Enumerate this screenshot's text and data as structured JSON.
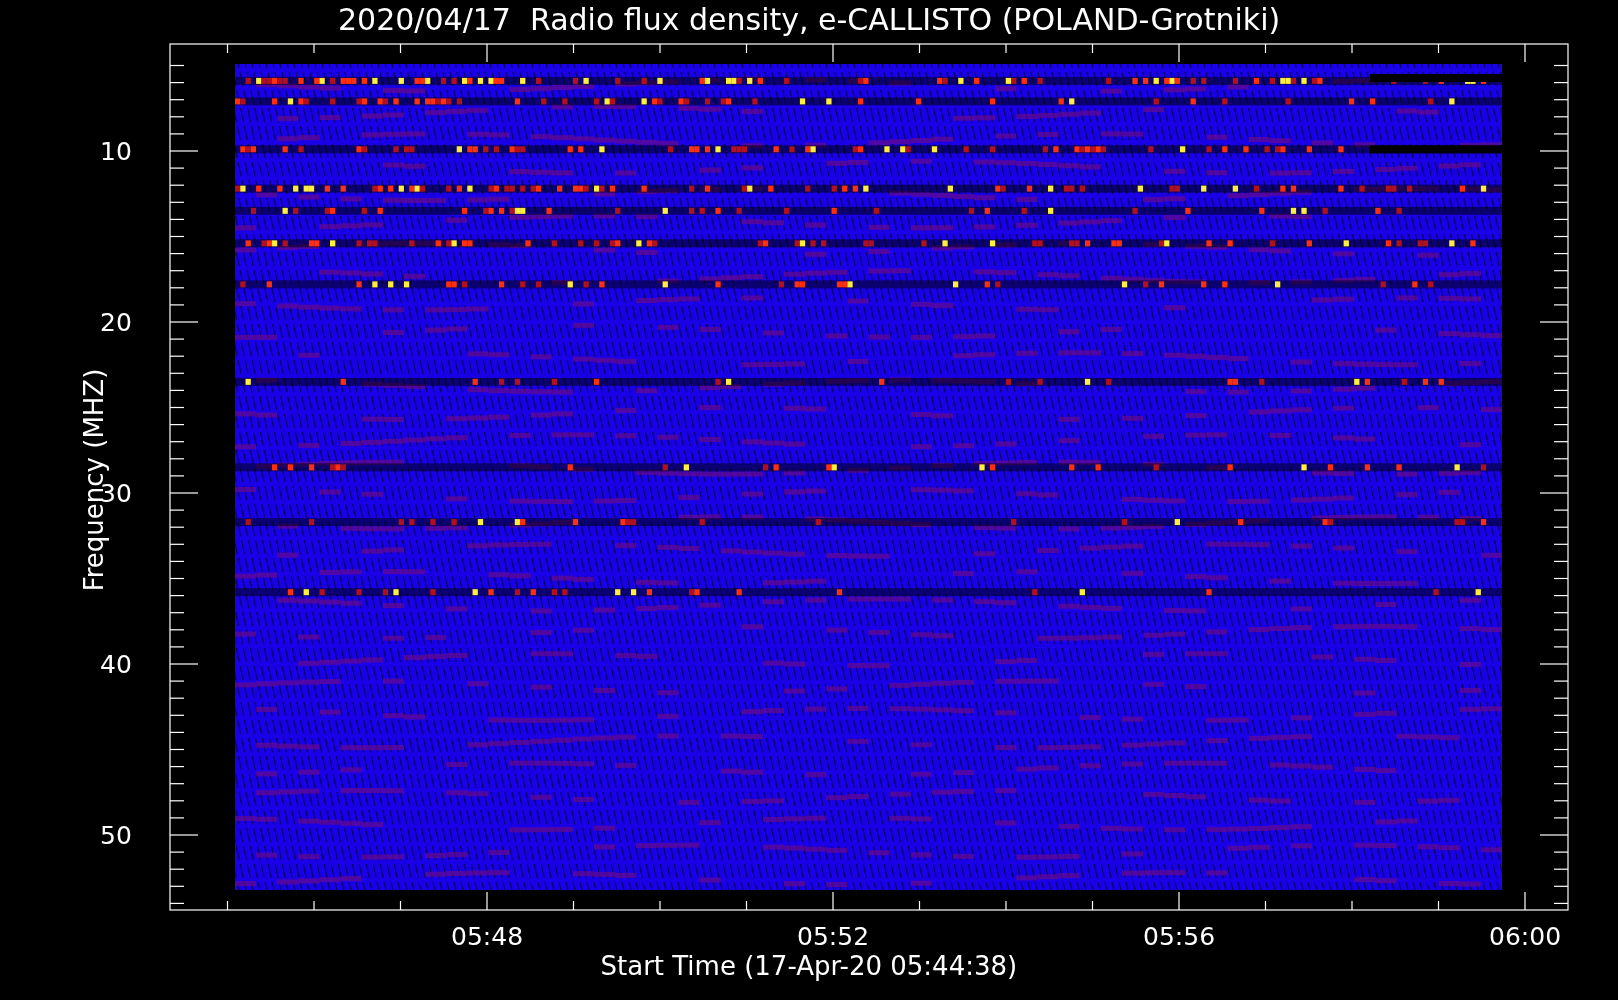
{
  "title": "2020/04/17  Radio flux density, e-CALLISTO (POLAND-Grotniki)",
  "plot": {
    "ylabel": "Frequency (MHZ)",
    "xlabel": "Start Time (17-Apr-20 05:44:38)",
    "yticks": [
      "10",
      "20",
      "30",
      "40",
      "50"
    ],
    "xticks": [
      "05:48",
      "05:52",
      "05:56",
      "06:00"
    ]
  }
}
